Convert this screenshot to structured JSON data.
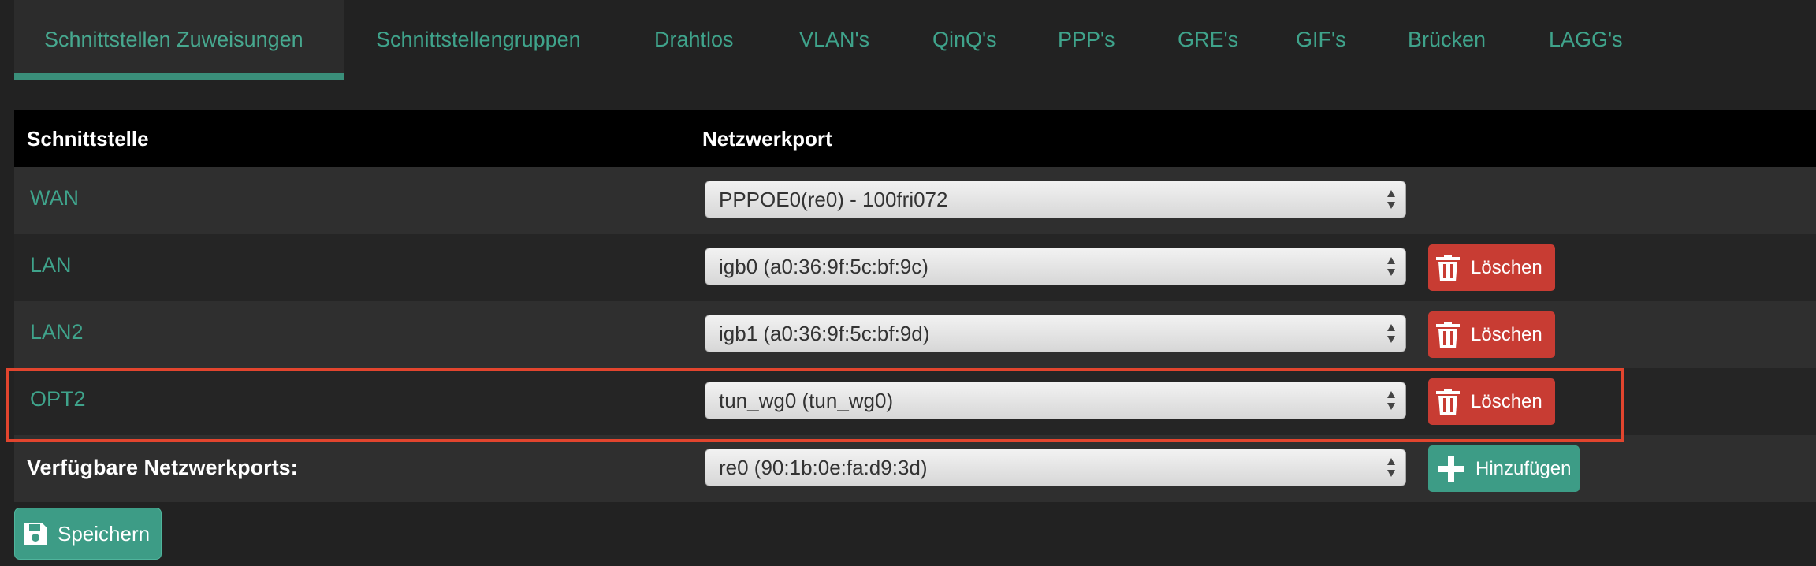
{
  "tabs": [
    {
      "label": "Schnittstellen Zuweisungen",
      "active": true
    },
    {
      "label": "Schnittstellengruppen"
    },
    {
      "label": "Drahtlos"
    },
    {
      "label": "VLAN's"
    },
    {
      "label": "QinQ's"
    },
    {
      "label": "PPP's"
    },
    {
      "label": "GRE's"
    },
    {
      "label": "GIF's"
    },
    {
      "label": "Brücken"
    },
    {
      "label": "LAGG's"
    }
  ],
  "table": {
    "headers": {
      "interface": "Schnittstelle",
      "port": "Netzwerkport"
    },
    "rows": [
      {
        "name": "WAN",
        "port": "PPPOE0(re0) - 100fri072"
      },
      {
        "name": "LAN",
        "port": "igb0 (a0:36:9f:5c:bf:9c)",
        "action": "Löschen"
      },
      {
        "name": "LAN2",
        "port": "igb1 (a0:36:9f:5c:bf:9d)",
        "action": "Löschen"
      },
      {
        "name": "OPT2",
        "port": "tun_wg0 (tun_wg0)",
        "action": "Löschen"
      }
    ],
    "available": {
      "label": "Verfügbare Netzwerkports:",
      "port": "re0 (90:1b:0e:fa:d9:3d)",
      "action": "Hinzufügen"
    }
  },
  "save_label": "Speichern",
  "colors": {
    "accent": "#3fa38b",
    "delete": "#c83c33",
    "add": "#3d9c86",
    "highlight": "#e2452e"
  },
  "icons": {
    "delete": "trash-icon",
    "add": "plus-icon",
    "save": "floppy-disk-icon",
    "select": "updown-arrows-icon"
  }
}
